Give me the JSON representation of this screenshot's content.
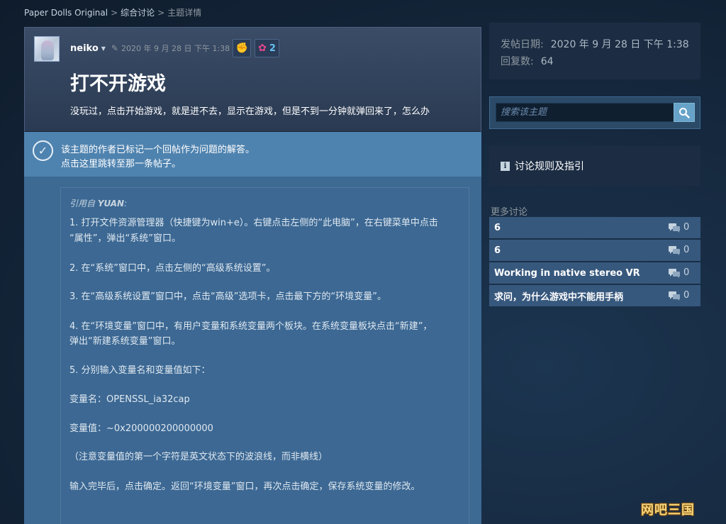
{
  "breadcrumb": {
    "items": [
      "Paper Dolls Original",
      "综合讨论"
    ],
    "current": "主题详情",
    "separator": ">"
  },
  "topic": {
    "author": "neiko",
    "date": "2020 年 9 月 28 日 下午 1:38",
    "award_count": "2",
    "title": "打不开游戏",
    "body": "没玩过，点击开始游戏，就是进不去，显示在游戏，但是不到一分钟就弹回来了，怎么办"
  },
  "answer_banner": {
    "line1": "该主题的作者已标记一个回帖作为问题的解答。",
    "line2": "点击这里跳转至那一条帖子。"
  },
  "quote": {
    "prefix": "引用自",
    "author": "YUAN",
    "suffix": ":",
    "lines": [
      "1. 打开文件资源管理器（快捷键为win+e）。右键点击左侧的“此电脑”，在右键菜单中点击",
      "“属性”，弹出“系统”窗口。",
      "2. 在“系统”窗口中，点击左侧的“高级系统设置”。",
      "3. 在“高级系统设置”窗口中，点击“高级”选项卡，点击最下方的“环境变量”。",
      "4. 在“环境变量”窗口中，有用户变量和系统变量两个板块。在系统变量板块点击“新建”，",
      "弹出“新建系统变量”窗口。",
      "5. 分别输入变量名和变量值如下：",
      "变量名：OPENSSL_ia32cap",
      "变量值：~0x200000200000000",
      "（注意变量值的第一个字符是英文状态下的波浪线，而非横线）",
      "输入完毕后，点击确定。返回“环境变量”窗口，再次点击确定，保存系统变量的修改。"
    ]
  },
  "meta": {
    "posted_label": "发帖日期:",
    "posted_value": "2020 年 9 月 28 日 下午 1:38",
    "replies_label": "回复数:",
    "replies_value": "64"
  },
  "search": {
    "placeholder": "搜索该主题"
  },
  "rules": {
    "label": "讨论规则及指引"
  },
  "more": {
    "title": "更多讨论",
    "items": [
      {
        "title": "6",
        "replies": "0"
      },
      {
        "title": "6",
        "replies": "0"
      },
      {
        "title": "Working in native stereo VR",
        "replies": "0"
      },
      {
        "title": "求问，为什么游戏中不能用手柄",
        "replies": "0"
      }
    ]
  },
  "watermark": {
    "text": "网吧三国"
  },
  "colors": {
    "accent": "#66c0f4",
    "banner": "#4f83af",
    "panel": "#3d6a93",
    "header": "#2a3a52"
  }
}
